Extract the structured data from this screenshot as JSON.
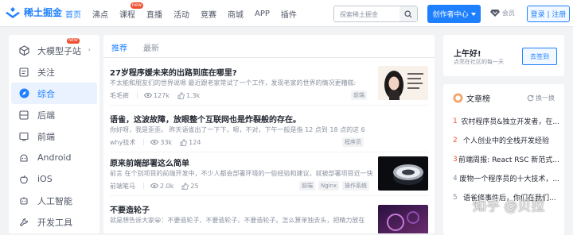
{
  "header": {
    "logo_text": "稀土掘金",
    "nav": [
      {
        "label": "首页",
        "active": true
      },
      {
        "label": "沸点"
      },
      {
        "label": "课程",
        "badge": "new"
      },
      {
        "label": "直播"
      },
      {
        "label": "活动"
      },
      {
        "label": "竞赛"
      },
      {
        "label": "商城"
      },
      {
        "label": "APP"
      },
      {
        "label": "插件"
      }
    ],
    "search_placeholder": "探索稀土掘金",
    "creator_label": "创作者中心",
    "vip_label": "会员",
    "login_label": "登录 | 注册"
  },
  "sidebar": {
    "items": [
      {
        "label": "大模型子站",
        "icon": "cube-icon",
        "badge": "NEW"
      },
      {
        "label": "关注",
        "icon": "follow-icon"
      },
      {
        "label": "综合",
        "icon": "compass-icon",
        "active": true
      },
      {
        "label": "后端",
        "icon": "backend-icon"
      },
      {
        "label": "前端",
        "icon": "frontend-icon"
      },
      {
        "label": "Android",
        "icon": "android-icon"
      },
      {
        "label": "iOS",
        "icon": "apple-icon"
      },
      {
        "label": "人工智能",
        "icon": "ai-icon"
      },
      {
        "label": "开发工具",
        "icon": "tools-icon"
      }
    ]
  },
  "feed": {
    "tabs": [
      "推荐",
      "最新"
    ],
    "articles": [
      {
        "title": "27岁程序媛未来的出路到底在哪里?",
        "abstract": "不太能和朋友们的世界说嗯 最近跟老家常试了一个工作，发现老家的世界的情况更糟糕:",
        "author": "毛毛裤",
        "views": "127k",
        "likes": "1.3k",
        "tags": [
          "前端"
        ]
      },
      {
        "title": "语雀，这波故障，放眼整个互联网也是炸裂般的存在。",
        "abstract": "你好呀，我是歪歪。 昨天语雀出了一下下，嗯，不对，下午一般是指 12 点到 18 点的这 6 个",
        "author": "why技术",
        "views": "33k",
        "likes": "124",
        "tags": [
          "程序员"
        ]
      },
      {
        "title": "原来前端部署这么简单",
        "abstract": "前言 在个别项目的前端开发中，不少人都会部署环境的一些经验和建议，就被部署项目近一快段经验和的部署，一点效果",
        "author": "前端笔马",
        "views": "2.0k",
        "likes": "25",
        "tags": [
          "前端",
          "Nginx",
          "操作系统"
        ]
      },
      {
        "title": "不要造轮子",
        "abstract": "就是想告诉大家😀：不要造轮子、不要造轮子、不要造轮子。怎么算单独去头，把精力放在",
        "author": "",
        "views": "",
        "likes": "",
        "tags": []
      }
    ]
  },
  "greeting": {
    "title": "上午好!",
    "subtitle": "点亮在社区的每一天",
    "signin_label": "去签到"
  },
  "ranking": {
    "title": "文章榜",
    "change_label": "换一换",
    "items": [
      {
        "num": "1",
        "text": "农村程序员&独立开发者，在..."
      },
      {
        "num": "2",
        "text": "个人创业中的全栈开发经验"
      },
      {
        "num": "3",
        "text": "前端周报: React RSC 新范式..."
      },
      {
        "num": "4",
        "text": "废物一个程序员的十大技术，..."
      },
      {
        "num": "5",
        "text": "语雀修事件后，你们在我们..."
      }
    ]
  },
  "watermark": "知乎 @贝拉",
  "colors": {
    "brand": "#1e80ff",
    "hot": "#ee502f"
  }
}
